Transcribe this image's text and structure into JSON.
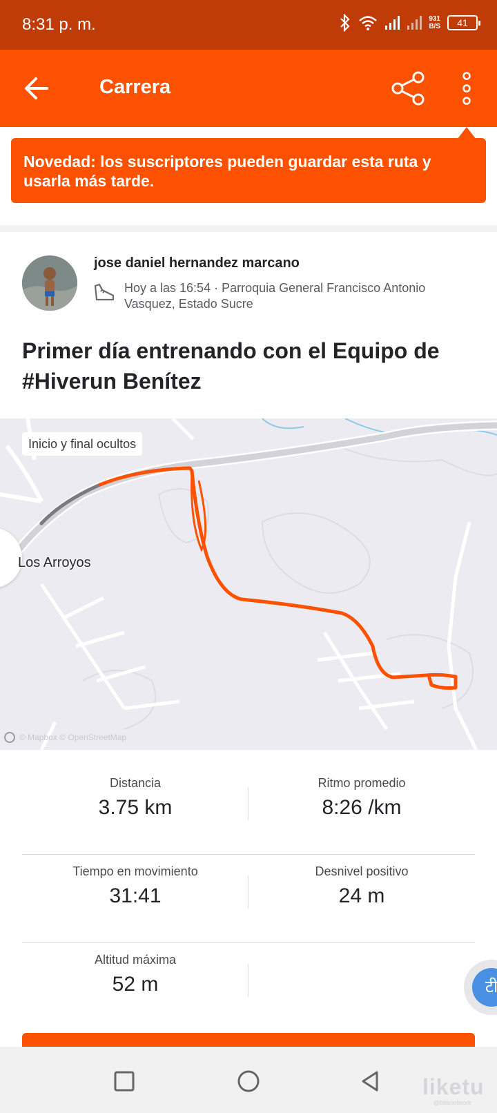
{
  "status_bar": {
    "time": "8:31 p. m.",
    "network_speed_value": "931",
    "network_speed_unit": "B/S",
    "battery": "41",
    "icons": [
      "bluetooth-icon",
      "wifi-icon",
      "signal-icon",
      "signal-icon",
      "battery-icon"
    ]
  },
  "app_bar": {
    "title": "Carrera",
    "back_icon": "arrow-left-icon",
    "share_icon": "share-icon",
    "more_icon": "more-vertical-icon"
  },
  "banner": {
    "text": "Novedad: los suscriptores pueden guardar esta ruta y usarla más tarde."
  },
  "activity": {
    "athlete_name": "jose daniel hernandez marcano",
    "meta": "Hoy a las 16:54 · Parroquia General Francisco Antonio Vasquez, Estado Sucre",
    "sport_icon": "running-shoe-icon",
    "title": "Primer día entrenando con el Equipo de #Hiverun Benítez"
  },
  "map": {
    "badge": "Inicio y final ocultos",
    "place_label": "Los Arroyos",
    "attribution": "© Mapbox © OpenStreetMap",
    "route_color": "#fc5200"
  },
  "stats": [
    {
      "label": "Distancia",
      "value": "3.75 km"
    },
    {
      "label": "Ritmo promedio",
      "value": "8:26 /km"
    },
    {
      "label": "Tiempo en movimiento",
      "value": "31:41"
    },
    {
      "label": "Desnivel positivo",
      "value": "24 m"
    },
    {
      "label": "Altitud máxima",
      "value": "52 m"
    }
  ],
  "floating": {
    "translate_glyph": "टी"
  },
  "watermark": {
    "text": "liketu",
    "sub": "@bitsnetwork"
  },
  "colors": {
    "accent": "#fc5200",
    "status_bar": "#bf3b08"
  }
}
